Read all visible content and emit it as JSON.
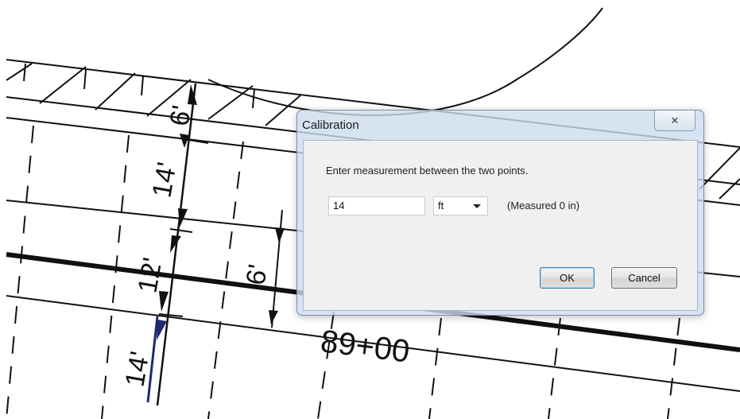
{
  "drawing": {
    "dimension_labels": [
      "6'",
      "14'",
      "12'",
      "6'",
      "14'"
    ],
    "station_label": "89+00"
  },
  "dialog": {
    "title": "Calibration",
    "close_glyph": "✕",
    "prompt": "Enter measurement between the two points.",
    "value": "14",
    "unit": "ft",
    "measured": "(Measured 0 in)",
    "ok_label": "OK",
    "cancel_label": "Cancel"
  }
}
